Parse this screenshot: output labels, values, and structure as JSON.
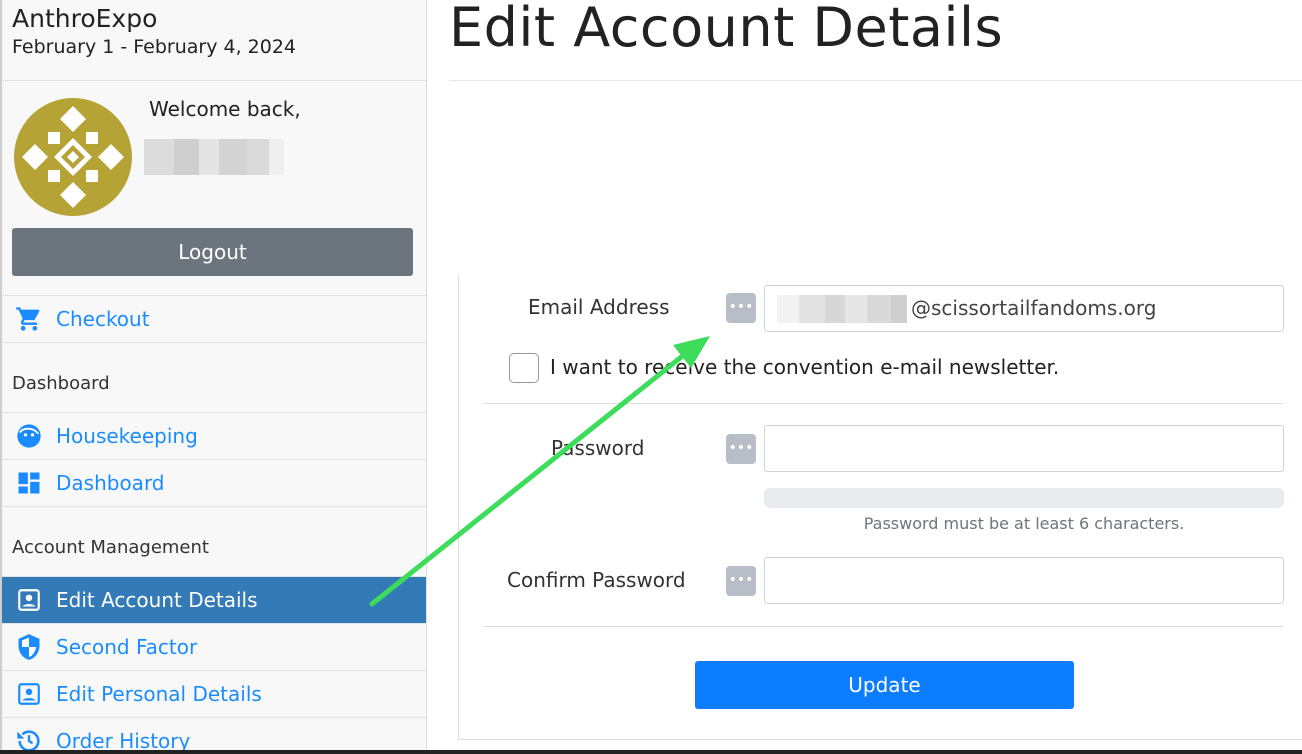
{
  "brand": {
    "name": "AnthroExpo",
    "dates": "February 1 - February 4, 2024"
  },
  "profile": {
    "welcome": "Welcome back,",
    "logout_label": "Logout"
  },
  "nav": {
    "checkout": "Checkout",
    "section_dashboard": "Dashboard",
    "housekeeping": "Housekeeping",
    "dashboard": "Dashboard",
    "section_account": "Account Management",
    "edit_account": "Edit Account Details",
    "second_factor": "Second Factor",
    "edit_personal": "Edit Personal Details",
    "order_history": "Order History"
  },
  "page": {
    "title": "Edit Account Details"
  },
  "form": {
    "email_label": "Email Address",
    "email_domain": "@scissortailfandoms.org",
    "info_glyph": "•••",
    "newsletter_label": "I want to receive the convention e-mail newsletter.",
    "password_label": "Password",
    "password_hint": "Password must be at least 6 characters.",
    "confirm_label": "Confirm Password",
    "update_label": "Update"
  },
  "colors": {
    "accent": "#1a8cff",
    "active_nav": "#337ab7",
    "update_button": "#0d7dff",
    "logout_button": "#6c757d",
    "avatar_gold": "#b5a336",
    "annotation_arrow": "#3ddc5a"
  },
  "icons": {
    "checkout": "cart-icon",
    "housekeeping": "face-icon",
    "dashboard": "dashboard-grid-icon",
    "edit_account": "account-box-icon",
    "second_factor": "shield-icon",
    "edit_personal": "account-box-icon",
    "order_history": "history-icon",
    "info": "more-dots-icon"
  }
}
